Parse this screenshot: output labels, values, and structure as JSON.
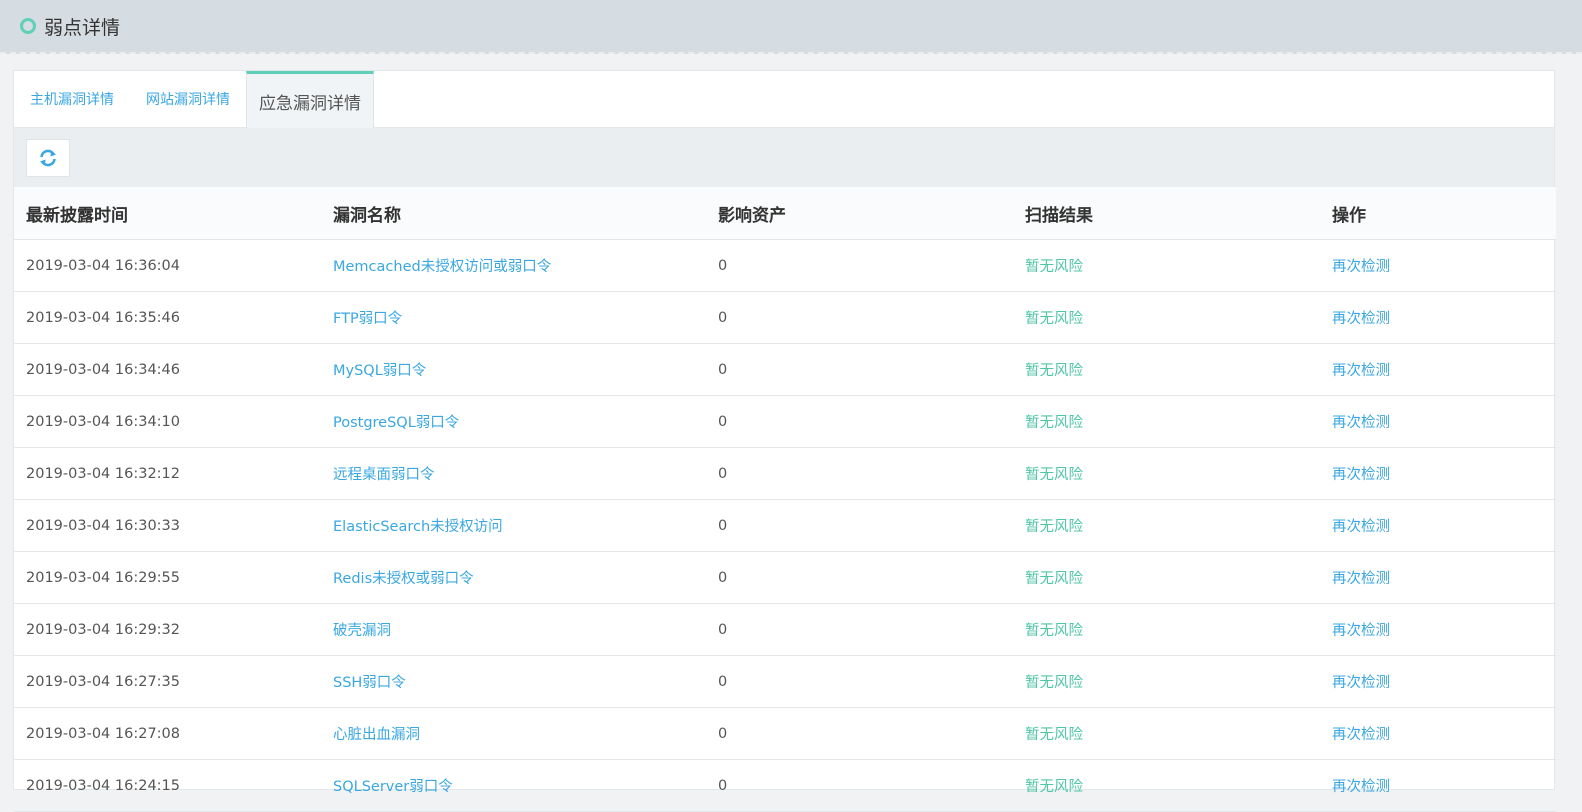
{
  "header": {
    "title": "弱点详情"
  },
  "tabs": [
    {
      "label": "主机漏洞详情"
    },
    {
      "label": "网站漏洞详情"
    },
    {
      "label": "应急漏洞详情"
    }
  ],
  "active_tab": 2,
  "table": {
    "columns": [
      "最新披露时间",
      "漏洞名称",
      "影响资产",
      "扫描结果",
      "操作"
    ],
    "rows": [
      {
        "time": "2019-03-04 16:36:04",
        "name": "Memcached未授权访问或弱口令",
        "assets": "0",
        "result": "暂无风险",
        "action": "再次检测"
      },
      {
        "time": "2019-03-04 16:35:46",
        "name": "FTP弱口令",
        "assets": "0",
        "result": "暂无风险",
        "action": "再次检测"
      },
      {
        "time": "2019-03-04 16:34:46",
        "name": "MySQL弱口令",
        "assets": "0",
        "result": "暂无风险",
        "action": "再次检测"
      },
      {
        "time": "2019-03-04 16:34:10",
        "name": "PostgreSQL弱口令",
        "assets": "0",
        "result": "暂无风险",
        "action": "再次检测"
      },
      {
        "time": "2019-03-04 16:32:12",
        "name": "远程桌面弱口令",
        "assets": "0",
        "result": "暂无风险",
        "action": "再次检测"
      },
      {
        "time": "2019-03-04 16:30:33",
        "name": "ElasticSearch未授权访问",
        "assets": "0",
        "result": "暂无风险",
        "action": "再次检测"
      },
      {
        "time": "2019-03-04 16:29:55",
        "name": "Redis未授权或弱口令",
        "assets": "0",
        "result": "暂无风险",
        "action": "再次检测"
      },
      {
        "time": "2019-03-04 16:29:32",
        "name": "破壳漏洞",
        "assets": "0",
        "result": "暂无风险",
        "action": "再次检测"
      },
      {
        "time": "2019-03-04 16:27:35",
        "name": "SSH弱口令",
        "assets": "0",
        "result": "暂无风险",
        "action": "再次检测"
      },
      {
        "time": "2019-03-04 16:27:08",
        "name": "心脏出血漏洞",
        "assets": "0",
        "result": "暂无风险",
        "action": "再次检测"
      },
      {
        "time": "2019-03-04 16:24:15",
        "name": "SQLServer弱口令",
        "assets": "0",
        "result": "暂无风险",
        "action": "再次检测"
      }
    ]
  },
  "colors": {
    "accent": "#5fcfb7",
    "link": "#3aa7e0",
    "safe": "#4fc6a6"
  },
  "icons": {
    "header": "circle-icon",
    "toolbar": "refresh-icon"
  }
}
